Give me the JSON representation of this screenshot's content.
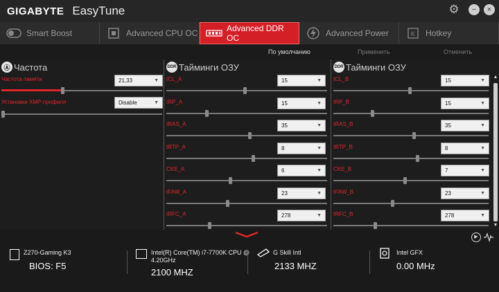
{
  "titlebar": {
    "brand": "GIGABYTE",
    "app": "EasyTune",
    "settings_icon": "gear-icon",
    "minimize_icon": "minus-icon",
    "close_icon": "close-icon"
  },
  "tabs": [
    {
      "label": "Smart Boost",
      "icon": "power-toggle-icon",
      "active": false
    },
    {
      "label": "Advanced CPU OC",
      "icon": "cpu-chip-icon",
      "active": false
    },
    {
      "label": "Advanced DDR OC",
      "icon": "ram-module-icon",
      "active": true
    },
    {
      "label": "Advanced Power",
      "icon": "lightning-icon",
      "active": false
    },
    {
      "label": "Hotkey",
      "icon": "key-icon",
      "active": false
    }
  ],
  "toolbar": {
    "default": "По умолчанию",
    "apply": "Применить",
    "cancel": "Отменить"
  },
  "left": {
    "title": "Частота",
    "icon": "frequency-icon",
    "mem_freq_label": "Частота памяти",
    "mem_freq_value": "21,33",
    "mem_freq_level": 0.38,
    "xmp_label": "Установки XMP-профиля",
    "xmp_value": "Disable",
    "xmp_level": 0.0
  },
  "mid": {
    "title": "Тайминги ОЗУ",
    "icon_text": "DDR",
    "rows": [
      {
        "label": "tCL_A",
        "value": "15",
        "level": 0.48
      },
      {
        "label": "tRP_A",
        "value": "15",
        "level": 0.24
      },
      {
        "label": "tRAS_A",
        "value": "35",
        "level": 0.51
      },
      {
        "label": "tRTP_A",
        "value": "8",
        "level": 0.53
      },
      {
        "label": "CKE_A",
        "value": "6",
        "level": 0.39
      },
      {
        "label": "tFAW_A",
        "value": "23",
        "level": 0.37
      },
      {
        "label": "tRFC_A",
        "value": "278",
        "level": 0.26
      }
    ]
  },
  "right": {
    "title": "Тайминги ОЗУ",
    "icon_text": "DDR",
    "rows": [
      {
        "label": "tCL_B",
        "value": "15",
        "level": 0.48
      },
      {
        "label": "tRP_B",
        "value": "15",
        "level": 0.24
      },
      {
        "label": "tRAS_B",
        "value": "35",
        "level": 0.51
      },
      {
        "label": "tRTP_B",
        "value": "8",
        "level": 0.53
      },
      {
        "label": "CKE_B",
        "value": "7",
        "level": 0.45
      },
      {
        "label": "tFAW_B",
        "value": "23",
        "level": 0.37
      },
      {
        "label": "tRFC_B",
        "value": "278",
        "level": 0.26
      }
    ]
  },
  "bottom": {
    "cells": [
      {
        "icon": "motherboard-icon",
        "line1": "Z270-Gaming K3",
        "line1b": "",
        "line2": "BIOS: F5"
      },
      {
        "icon": "cpu-icon",
        "line1": "Intel(R) Core(TM) i7-7700K CPU @",
        "line1b": "4.20GHz",
        "line2": "2100 MHZ"
      },
      {
        "icon": "memory-icon",
        "line1": "G Skill Intl",
        "line1b": "",
        "line2": "2133 MHZ"
      },
      {
        "icon": "gpu-icon",
        "line1": "Intel GFX",
        "line1b": "",
        "line2": "0.00 MHz"
      }
    ],
    "play_icon": "play-icon",
    "monitor_icon": "waveform-icon",
    "expand_icon": "chevron-down-icon"
  },
  "colors": {
    "accent": "#d41f26",
    "label_red": "#e0262b",
    "background": "#1e1e1e"
  }
}
